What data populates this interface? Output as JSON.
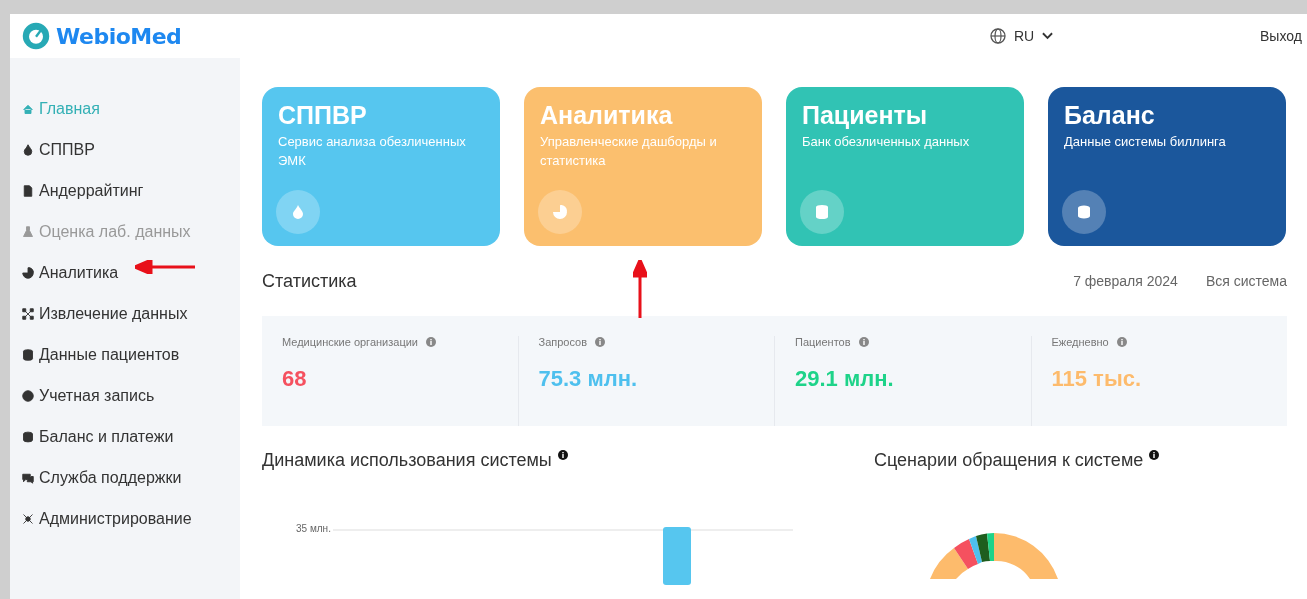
{
  "header": {
    "logo": "WebioMed",
    "language": "RU",
    "logout": "Выход"
  },
  "sidebar": {
    "items": [
      {
        "label": "Главная",
        "selected": true,
        "disabled": false
      },
      {
        "label": "СППВР",
        "selected": false,
        "disabled": false
      },
      {
        "label": "Андеррайтинг",
        "selected": false,
        "disabled": false
      },
      {
        "label": "Оценка лаб. данных",
        "selected": false,
        "disabled": true
      },
      {
        "label": "Аналитика",
        "selected": false,
        "disabled": false
      },
      {
        "label": "Извлечение данных",
        "selected": false,
        "disabled": false
      },
      {
        "label": "Данные пациентов",
        "selected": false,
        "disabled": false
      },
      {
        "label": "Учетная запись",
        "selected": false,
        "disabled": false
      },
      {
        "label": "Баланс и платежи",
        "selected": false,
        "disabled": false
      },
      {
        "label": "Служба поддержки",
        "selected": false,
        "disabled": false
      },
      {
        "label": "Администрирование",
        "selected": false,
        "disabled": false
      }
    ]
  },
  "cards": [
    {
      "title": "СППВР",
      "subtitle": "Сервис анализа обезличенных ЭМК",
      "color": "#56c6ef"
    },
    {
      "title": "Аналитика",
      "subtitle": "Управленческие дашборды и статистика",
      "color": "#fbbf6e"
    },
    {
      "title": "Пациенты",
      "subtitle": "Банк обезличенных данных",
      "color": "#31c3b4"
    },
    {
      "title": "Баланс",
      "subtitle": "Данные системы биллинга",
      "color": "#1b579c"
    }
  ],
  "statistics": {
    "title": "Статистика",
    "date": "7 февраля 2024",
    "scope": "Вся система",
    "metrics": [
      {
        "label": "Медицинские организации",
        "value": "68",
        "color": "#f5515f"
      },
      {
        "label": "Запросов",
        "value": "75.3 млн.",
        "color": "#4ec0ee"
      },
      {
        "label": "Пациентов",
        "value": "29.1 млн.",
        "color": "#1ed389"
      },
      {
        "label": "Ежедневно",
        "value": "115 тыс.",
        "color": "#fdbb6c"
      }
    ]
  },
  "usage_chart": {
    "title": "Динамика использования системы",
    "tick": "35 млн."
  },
  "scenarios_chart": {
    "title": "Сценарии обращения к системе"
  },
  "annotations": [
    {
      "kind": "arrow-left"
    },
    {
      "kind": "arrow-up"
    }
  ]
}
